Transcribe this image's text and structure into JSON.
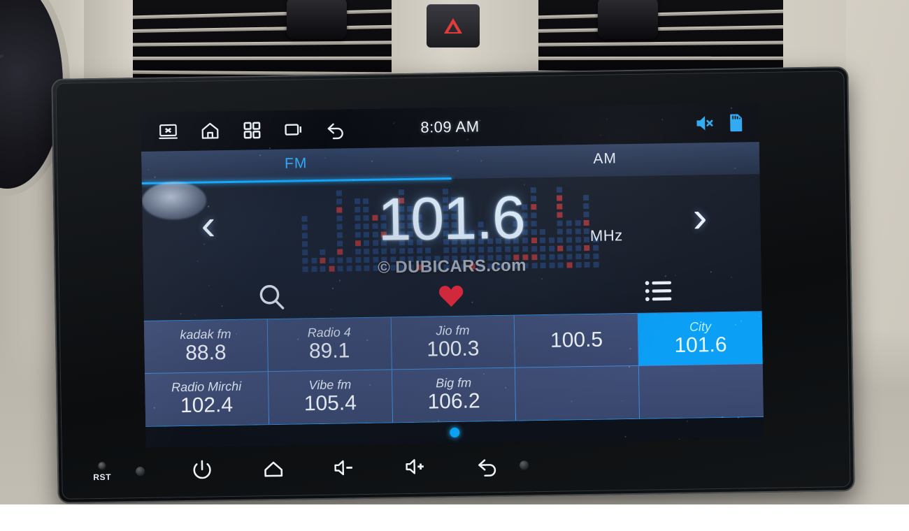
{
  "scene": {
    "description": "car-dashboard-android-head-unit-fm-radio"
  },
  "status_bar": {
    "time": "8:09 AM",
    "left_icons": [
      {
        "name": "screen-off-icon",
        "glyph": "display-x"
      },
      {
        "name": "home-icon",
        "glyph": "home"
      },
      {
        "name": "apps-icon",
        "glyph": "grid"
      },
      {
        "name": "recents-icon",
        "glyph": "window"
      },
      {
        "name": "back-icon",
        "glyph": "arrow-back"
      }
    ],
    "right_icons": [
      {
        "name": "mute-icon",
        "glyph": "speaker-muted",
        "color": "#2aa8f2"
      },
      {
        "name": "sd-card-icon",
        "glyph": "sd-card",
        "color": "#2aa8f2"
      }
    ]
  },
  "band_tabs": {
    "tabs": [
      {
        "label": "FM",
        "selected": true
      },
      {
        "label": "AM",
        "selected": false
      }
    ],
    "active_color": "#2fa9f5",
    "inactive_color": "#dfe7f2",
    "underline_color": "#11a7ff"
  },
  "tuner": {
    "frequency": "101.6",
    "unit": "MHz",
    "prev_label": "‹",
    "next_label": "›",
    "watermark": "© DUBICARS.com"
  },
  "actions": [
    {
      "name": "search-icon",
      "label": "Search"
    },
    {
      "name": "favorite-heart-icon",
      "label": "Favorite",
      "color": "#f0283c"
    },
    {
      "name": "station-list-icon",
      "label": "Station list"
    }
  ],
  "presets": {
    "columns": 5,
    "rows": 2,
    "selected_color": "#0b9ff5",
    "items": [
      {
        "name": "kadak fm",
        "freq": "88.8",
        "selected": false
      },
      {
        "name": "Radio 4",
        "freq": "89.1",
        "selected": false
      },
      {
        "name": "Jio fm",
        "freq": "100.3",
        "selected": false
      },
      {
        "name": "",
        "freq": "100.5",
        "selected": false
      },
      {
        "name": "City",
        "freq": "101.6",
        "selected": true
      },
      {
        "name": "Radio Mirchi",
        "freq": "102.4",
        "selected": false
      },
      {
        "name": "Vibe fm",
        "freq": "105.4",
        "selected": false
      },
      {
        "name": "Big fm",
        "freq": "106.2",
        "selected": false
      },
      {
        "name": "",
        "freq": "",
        "selected": false
      },
      {
        "name": "",
        "freq": "",
        "selected": false
      }
    ]
  },
  "pager": {
    "pages": 1,
    "current": 1,
    "dot_color": "#09a4f5"
  },
  "hardware_buttons": [
    {
      "name": "reset-pinhole",
      "label": "RST"
    },
    {
      "name": "status-led",
      "label": ""
    },
    {
      "name": "power-button",
      "label": ""
    },
    {
      "name": "home-button",
      "label": ""
    },
    {
      "name": "volume-down-button",
      "label": ""
    },
    {
      "name": "volume-up-button",
      "label": ""
    },
    {
      "name": "back-button",
      "label": ""
    },
    {
      "name": "ir-sensor",
      "label": ""
    }
  ]
}
